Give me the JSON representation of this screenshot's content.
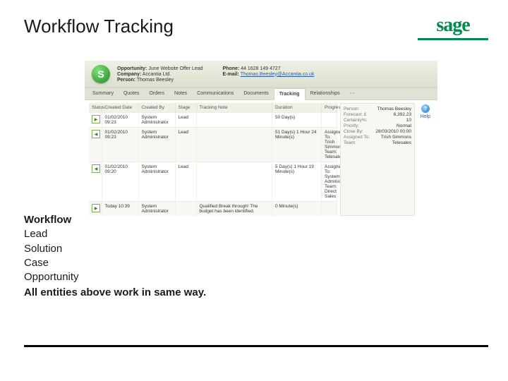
{
  "title": "Workflow Tracking",
  "logo": {
    "text": "sage"
  },
  "record": {
    "icon_glyph": "S",
    "left": [
      {
        "k": "Opportunity:",
        "v": "June Website Offer Lead"
      },
      {
        "k": "Company:",
        "v": "Accantia Ltd."
      },
      {
        "k": "Person:",
        "v": "Thomas Beesley"
      }
    ],
    "right": [
      {
        "k": "Phone:",
        "v": "44 1628 149 4727"
      },
      {
        "k": "E-mail:",
        "v": "Thomas.Beesley@Accantia.co.uk",
        "link": true
      }
    ]
  },
  "tabs": [
    "Summary",
    "Quotes",
    "Orders",
    "Notes",
    "Communications",
    "Documents",
    "Tracking",
    "Relationships",
    "···"
  ],
  "active_tab": "Tracking",
  "columns": [
    "Status",
    "Created Date",
    "Created By",
    "Stage",
    "Tracking Note",
    "Duration",
    "Progress"
  ],
  "rows": [
    {
      "arrow": "▶",
      "date": "01/02/2010 09:23",
      "by": "System Administrator",
      "stage": "Lead",
      "note": "",
      "duration": "50 Day(s)",
      "progress": ""
    },
    {
      "arrow": "◀",
      "date": "01/02/2010 09:23",
      "by": "System Administrator",
      "stage": "Lead",
      "note": "",
      "duration": "51 Day(s) 1 Hour 24 Minute(s)",
      "progress": "Assigned To: Trish Simmons  Team: Telesales"
    },
    {
      "arrow": "◀",
      "date": "01/02/2010 09:20",
      "by": "System Administrator",
      "stage": "Lead",
      "note": "",
      "duration": "5 Day(s) 1 Hour 19 Minute(s)",
      "progress": "Assigned To: System Administrator  Team: Direct Sales"
    },
    {
      "arrow": "▶",
      "date": "Today 10:39",
      "by": "System Administrator",
      "stage": "",
      "note": "Qualified Break through! The budget has been identified.",
      "duration": "0 Minute(s)",
      "progress": ""
    }
  ],
  "side_panel": [
    {
      "k": "Person:",
      "v": "Thomas Beesley"
    },
    {
      "k": "Forecast: £",
      "v": "6,392.23"
    },
    {
      "k": "Certainty%:",
      "v": "10"
    },
    {
      "k": "Priority:",
      "v": "Normal"
    },
    {
      "k": "Close By:",
      "v": "28/03/2010 00:00"
    },
    {
      "k": "Assigned To:",
      "v": "Trish Simmons"
    },
    {
      "k": "Team:",
      "v": "Telesales"
    }
  ],
  "help_label": "Help",
  "copy": {
    "heading": "Workflow",
    "items": [
      "Lead",
      "Solution",
      "Case",
      "Opportunity"
    ],
    "closing": "All entities above work in same way."
  }
}
